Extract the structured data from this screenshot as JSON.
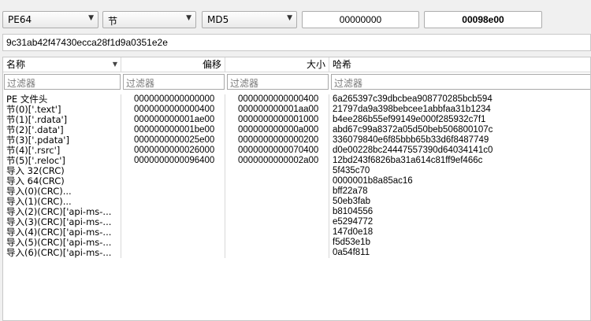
{
  "toolbar": {
    "type_combo": "PE64",
    "section_combo": "节",
    "method_combo": "MD5",
    "offset_field": "00000000",
    "size_field": "00098e00"
  },
  "hash_value": "9c31ab42f47430ecca28f1d9a0351e2e",
  "columns": [
    "名称",
    "偏移",
    "大小",
    "哈希"
  ],
  "filter_placeholder": "过滤器",
  "rows": [
    {
      "name": "PE 文件头",
      "offset": "0000000000000000",
      "size": "0000000000000400",
      "hash": "6a265397c39dbcbea908770285bcb594"
    },
    {
      "name": "节(0)['.text']",
      "offset": "0000000000000400",
      "size": "000000000001aa00",
      "hash": "21797da9a398bebcee1abbfaa31b1234"
    },
    {
      "name": "节(1)['.rdata']",
      "offset": "000000000001ae00",
      "size": "0000000000001000",
      "hash": "b4ee286b55ef99149e000f285932c7f1"
    },
    {
      "name": "节(2)['.data']",
      "offset": "000000000001be00",
      "size": "000000000000a000",
      "hash": "abd67c99a8372a05d50beb506800107c"
    },
    {
      "name": "节(3)['.pdata']",
      "offset": "0000000000025e00",
      "size": "0000000000000200",
      "hash": "336079840e6f85bbb65b33d6f8487749"
    },
    {
      "name": "节(4)['.rsrc']",
      "offset": "0000000000026000",
      "size": "0000000000070400",
      "hash": "d0e00228bc24447557390d64034141c0"
    },
    {
      "name": "节(5)['.reloc']",
      "offset": "0000000000096400",
      "size": "0000000000002a00",
      "hash": "12bd243f6826ba31a614c81ff9ef466c"
    },
    {
      "name": "导入 32(CRC)",
      "offset": "",
      "size": "",
      "hash": "5f435c70"
    },
    {
      "name": "导入 64(CRC)",
      "offset": "",
      "size": "",
      "hash": "0000001b8a85ac16"
    },
    {
      "name": "导入(0)(CRC)...",
      "offset": "",
      "size": "",
      "hash": "bff22a78"
    },
    {
      "name": "导入(1)(CRC)...",
      "offset": "",
      "size": "",
      "hash": "50eb3fab"
    },
    {
      "name": "导入(2)(CRC)['api-ms-...",
      "offset": "",
      "size": "",
      "hash": "b8104556"
    },
    {
      "name": "导入(3)(CRC)['api-ms-...",
      "offset": "",
      "size": "",
      "hash": "e5294772"
    },
    {
      "name": "导入(4)(CRC)['api-ms-...",
      "offset": "",
      "size": "",
      "hash": "147d0e18"
    },
    {
      "name": "导入(5)(CRC)['api-ms-...",
      "offset": "",
      "size": "",
      "hash": "f5d53e1b"
    },
    {
      "name": "导入(6)(CRC)['api-ms-...",
      "offset": "",
      "size": "",
      "hash": "0a54f811"
    }
  ]
}
